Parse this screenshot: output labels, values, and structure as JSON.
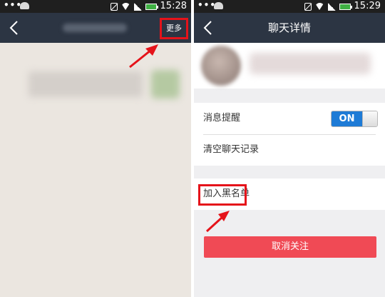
{
  "left_screen": {
    "status": {
      "dots": "•••",
      "time": "15:28"
    },
    "nav": {
      "more_label": "更多"
    }
  },
  "right_screen": {
    "status": {
      "dots": "•••",
      "time": "15:29"
    },
    "nav": {
      "title": "聊天详情"
    },
    "settings": {
      "notify_label": "消息提醒",
      "notify_toggle": "ON",
      "clear_label": "清空聊天记录",
      "blacklist_label": "加入黑名单"
    },
    "cancel_button": "取消关注"
  },
  "colors": {
    "navbar": "#2c3543",
    "highlight": "#e5131a",
    "toggle_on": "#1e7bd6",
    "cancel_button": "#f04a55"
  }
}
